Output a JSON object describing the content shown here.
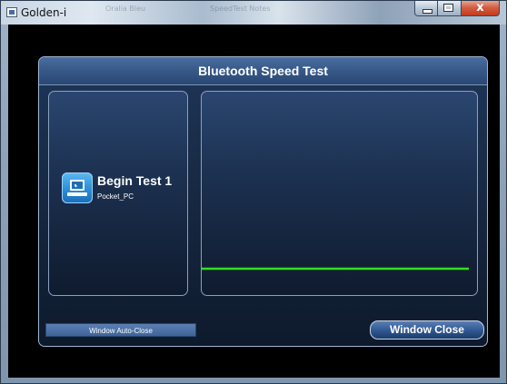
{
  "window": {
    "title": "Golden-i",
    "faint_texts": [
      "Oralia Bleu",
      "SpeedTest Notes"
    ],
    "controls": [
      "minimize-icon",
      "maximize-icon",
      "close-icon"
    ],
    "close_glyph": "x"
  },
  "dialog": {
    "title": "Bluetooth Speed Test",
    "device": {
      "label": "Begin Test 1",
      "name": "Pocket_PC",
      "icon": "laptop-device-icon"
    },
    "graph": {
      "line_color": "#33e01c",
      "progress": 0.0
    },
    "auto_close_label": "Window Auto-Close",
    "close_button_label": "Window Close"
  },
  "colors": {
    "accent": "#3f6499",
    "header": "#375887",
    "background": "#000000",
    "speed_line": "#33e01c"
  }
}
